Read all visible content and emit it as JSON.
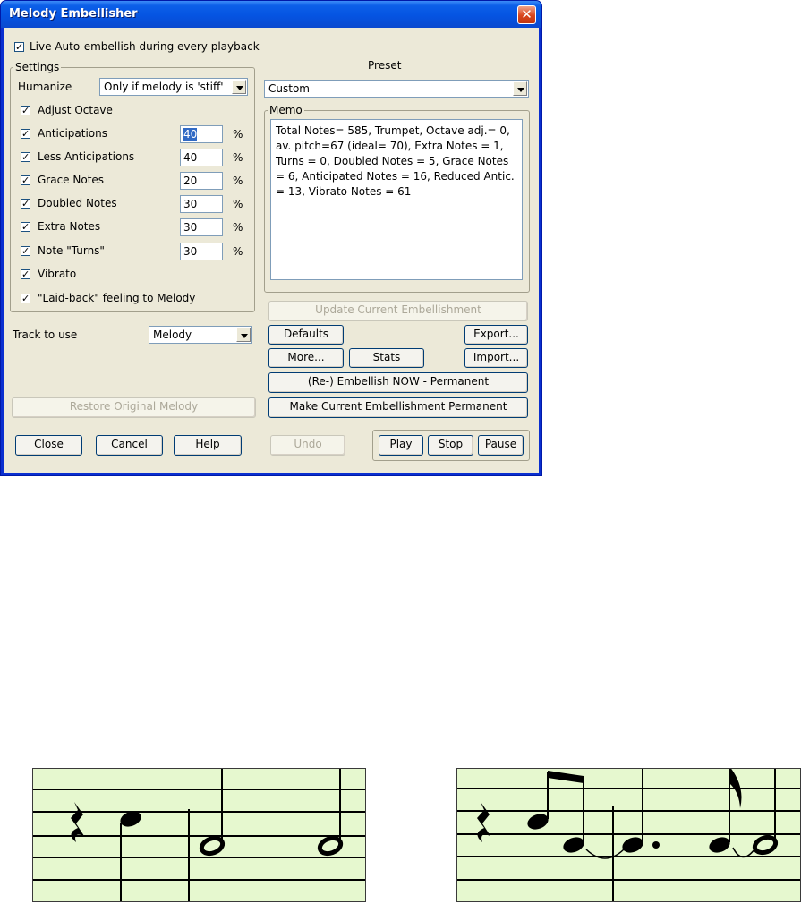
{
  "window": {
    "title": "Melody Embellisher"
  },
  "live_auto": {
    "label": "Live Auto-embellish during every playback",
    "checked": true
  },
  "settings": {
    "title": "Settings",
    "humanize": {
      "label": "Humanize",
      "value": "Only if melody is 'stiff'"
    },
    "adjust_octave": {
      "label": "Adjust Octave",
      "checked": true
    },
    "rows": [
      {
        "label": "Anticipations",
        "value": "40",
        "unit": "%",
        "checked": true
      },
      {
        "label": "Less Anticipations",
        "value": "40",
        "unit": "%",
        "checked": true
      },
      {
        "label": "Grace Notes",
        "value": "20",
        "unit": "%",
        "checked": true
      },
      {
        "label": "Doubled Notes",
        "value": "30",
        "unit": "%",
        "checked": true
      },
      {
        "label": "Extra Notes",
        "value": "30",
        "unit": "%",
        "checked": true
      },
      {
        "label": "Note \"Turns\"",
        "value": "30",
        "unit": "%",
        "checked": true
      }
    ],
    "vibrato": {
      "label": "Vibrato",
      "checked": true
    },
    "laid_back": {
      "label": "\"Laid-back\" feeling to Melody",
      "checked": true
    }
  },
  "track": {
    "label": "Track to use",
    "value": "Melody"
  },
  "preset": {
    "label": "Preset",
    "value": "Custom"
  },
  "memo": {
    "title": "Memo",
    "text": "Total Notes= 585,  Trumpet, Octave adj.= 0, av. pitch=67 (ideal= 70), Extra Notes = 1,  Turns = 0,  Doubled  Notes = 5,  Grace Notes = 6,  Anticipated Notes = 16,  Reduced Antic. = 13,  Vibrato Notes = 61"
  },
  "buttons": {
    "update": "Update Current Embellishment",
    "defaults": "Defaults",
    "export": "Export...",
    "more": "More...",
    "stats": "Stats",
    "import": "Import...",
    "reembellish": "(Re-) Embellish NOW - Permanent",
    "make_permanent": "Make Current Embellishment Permanent",
    "restore": "Restore Original Melody",
    "close": "Close",
    "cancel": "Cancel",
    "help": "Help",
    "undo": "Undo",
    "play": "Play",
    "stop": "Stop",
    "pause": "Pause"
  },
  "colors": {
    "title_bar": "#0554e2",
    "dialog_bg": "#ece9d8",
    "staff_bg": "#e6f8cf"
  }
}
